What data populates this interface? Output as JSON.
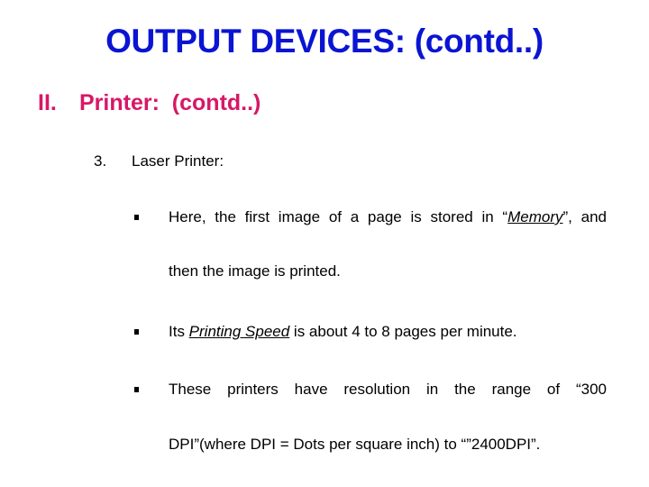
{
  "slide": {
    "title": "OUTPUT DEVICES: (contd..)",
    "section": {
      "number": "II.",
      "label": "Printer:  (contd..)"
    },
    "item": {
      "number": "3.",
      "label": "Laser Printer:"
    },
    "bullets": [
      {
        "line1_pre": "Here, the first image of a page is stored in “",
        "line1_em": "Memory",
        "line1_post": "”, and",
        "line2": "then the image is printed."
      },
      {
        "pre": "Its ",
        "em": "Printing Speed",
        "post": " is about 4 to 8 pages per minute."
      },
      {
        "line1": "These printers have resolution in the range of “300",
        "line2": "DPI”(where DPI = Dots per square inch) to “”2400DPI”."
      }
    ]
  },
  "colors": {
    "title": "#0a14d2",
    "section": "#d81767",
    "body": "#000000"
  }
}
